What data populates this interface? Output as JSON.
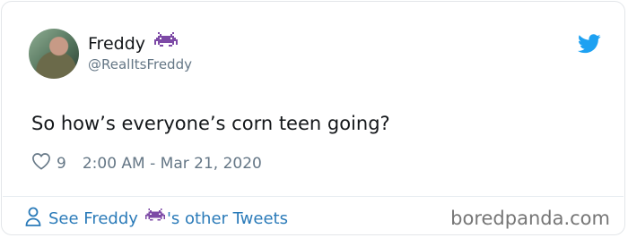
{
  "tweet": {
    "author_name": "Freddy",
    "handle": "@RealItsFreddy",
    "text": "So how’s everyone’s corn teen going?",
    "likes": "9",
    "timestamp": "2:00 AM - Mar 21, 2020"
  },
  "footer": {
    "see_prefix": "See Freddy",
    "see_suffix": "'s other Tweets"
  },
  "watermark": "boredpanda.com",
  "colors": {
    "link": "#2b7bb9",
    "twitter_blue": "#1da1f2",
    "invader_purple": "#7d4aa6",
    "muted": "#657786"
  },
  "icons": {
    "bird": "twitter-bird-icon",
    "heart": "heart-icon",
    "person": "person-icon",
    "invader": "space-invader-emoji"
  }
}
